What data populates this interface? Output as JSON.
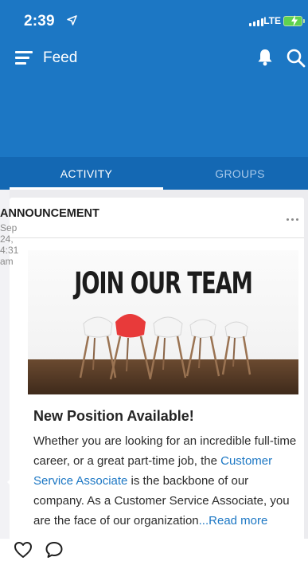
{
  "status_bar": {
    "time": "2:39",
    "network": "LTE"
  },
  "app_bar": {
    "title": "Feed",
    "icons": [
      "menu-icon",
      "bell-icon",
      "search-icon"
    ]
  },
  "tabs": [
    {
      "label": "ACTIVITY",
      "active": true
    },
    {
      "label": "GROUPS",
      "active": false
    }
  ],
  "post": {
    "type": "ANNOUNCEMENT",
    "date": "Sep 24, 4:31 am",
    "image_text": "JOIN OUR TEAM",
    "title": "New Position Available!",
    "body_before_link": "Whether you are looking for an incredible full-time career, or a great part-time job, the ",
    "link_text": "Customer Service Associate",
    "body_after_link": " is the backbone of our company. As a Customer Service Associate, you are the face of our organization",
    "read_more": "...Read more"
  },
  "colors": {
    "brand_blue": "#1c77c4",
    "tab_bar": "#1468b3"
  }
}
